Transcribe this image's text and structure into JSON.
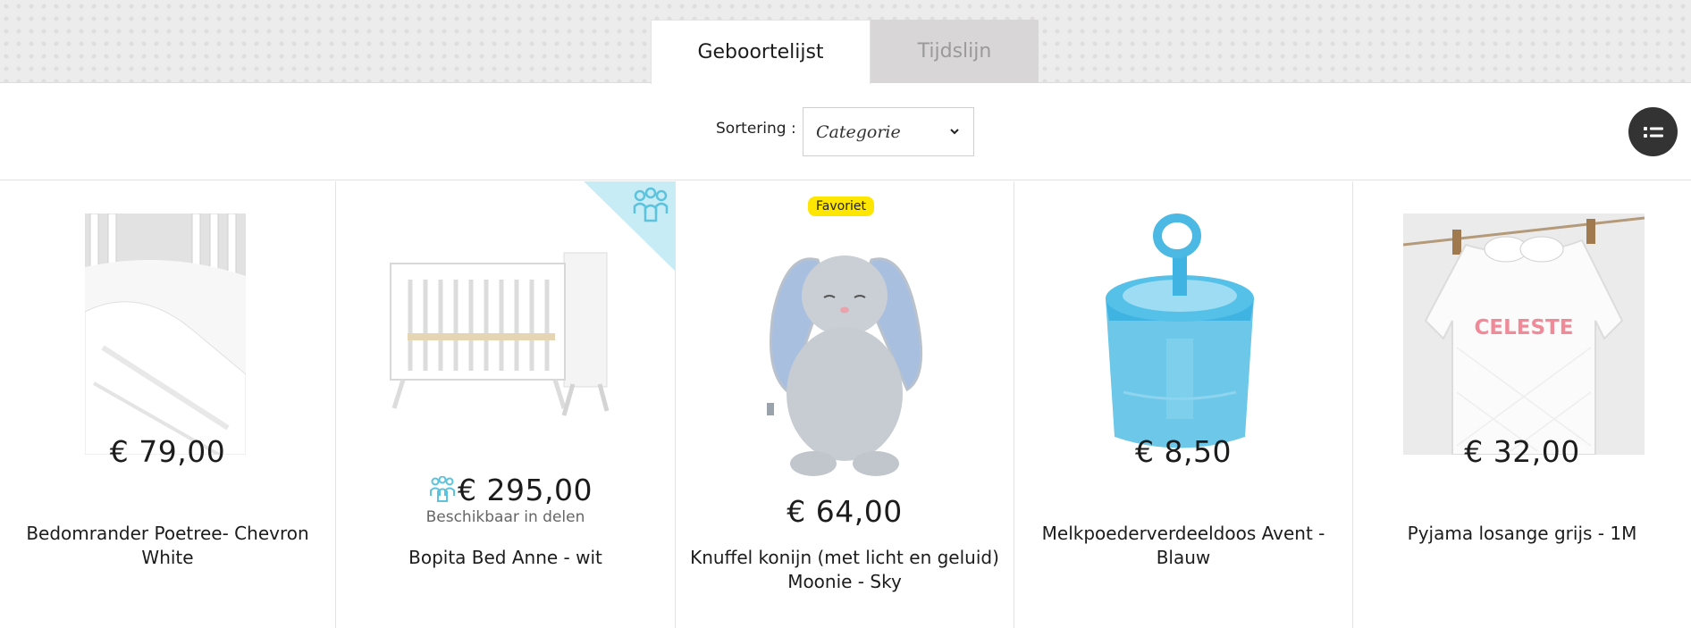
{
  "tabs": [
    {
      "label": "Geboortelijst",
      "active": true
    },
    {
      "label": "Tijdslijn",
      "active": false
    }
  ],
  "sort": {
    "label": "Sortering :",
    "value": "Categorie"
  },
  "icons": {
    "chevron": "chevron-down-icon",
    "view_toggle": "list-view-icon",
    "group_gift": "group-gift-icon"
  },
  "colors": {
    "accent": "#5bc3dd",
    "badge": "#ffe600",
    "view_button": "#333333"
  },
  "products": [
    {
      "price": "€ 79,00",
      "name": "Bedomrander Poetree- Chevron White"
    },
    {
      "price": "€ 295,00",
      "name": "Bopita Bed Anne - wit",
      "sub": "Beschikbaar in delen"
    },
    {
      "price": "€ 64,00",
      "name": "Knuffel konijn (met licht en geluid) Moonie - Sky",
      "badge": "Favoriet"
    },
    {
      "price": "€ 8,50",
      "name": "Melkpoederverdeeldoos Avent - Blauw"
    },
    {
      "price": "€ 32,00",
      "name": "Pyjama losange grijs - 1M",
      "embroidery": "CELESTE"
    }
  ]
}
